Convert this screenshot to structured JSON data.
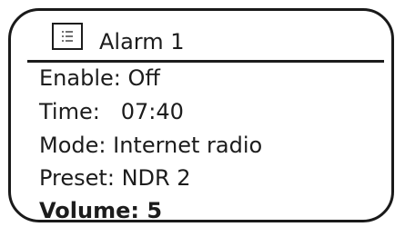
{
  "header": {
    "icon": "menu-list-icon",
    "title": "Alarm 1"
  },
  "settings": [
    {
      "label": "Enable:",
      "value": "Off"
    },
    {
      "label": "Time:",
      "value": "07:40"
    },
    {
      "label": "Mode:",
      "value": "Internet radio"
    },
    {
      "label": "Preset:",
      "value": "NDR 2"
    },
    {
      "label": "Volume:",
      "value": "5",
      "selected": true
    }
  ]
}
